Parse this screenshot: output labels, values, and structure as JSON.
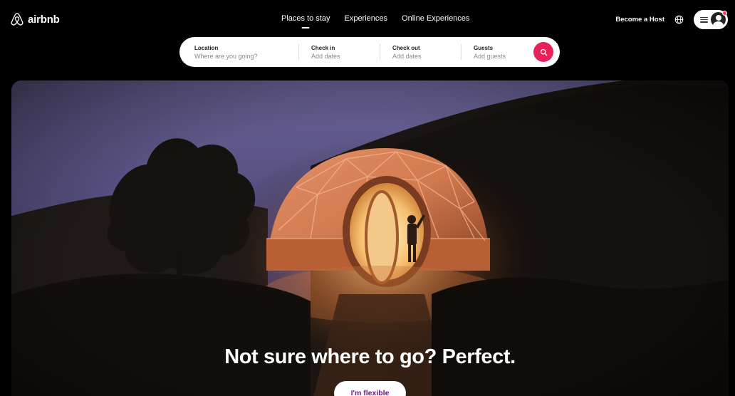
{
  "brand": {
    "name": "airbnb",
    "accent": "#ff385c",
    "search_button_color": "#e8215a",
    "flexible_text_color": "#6b1e84"
  },
  "nav": {
    "items": [
      {
        "label": "Places to stay",
        "active": true
      },
      {
        "label": "Experiences",
        "active": false
      },
      {
        "label": "Online Experiences",
        "active": false
      }
    ]
  },
  "header_right": {
    "host_label": "Become a Host",
    "globe_icon": "globe-icon",
    "menu_icon": "hamburger-icon",
    "avatar_icon": "user-avatar-icon"
  },
  "search": {
    "location": {
      "label": "Location",
      "placeholder": "Where are you going?"
    },
    "check_in": {
      "label": "Check in",
      "placeholder": "Add dates"
    },
    "check_out": {
      "label": "Check out",
      "placeholder": "Add dates"
    },
    "guests": {
      "label": "Guests",
      "placeholder": "Add guests"
    },
    "button_icon": "search-icon"
  },
  "hero": {
    "title": "Not sure where to go? Perfect.",
    "cta_label": "I'm flexible"
  }
}
